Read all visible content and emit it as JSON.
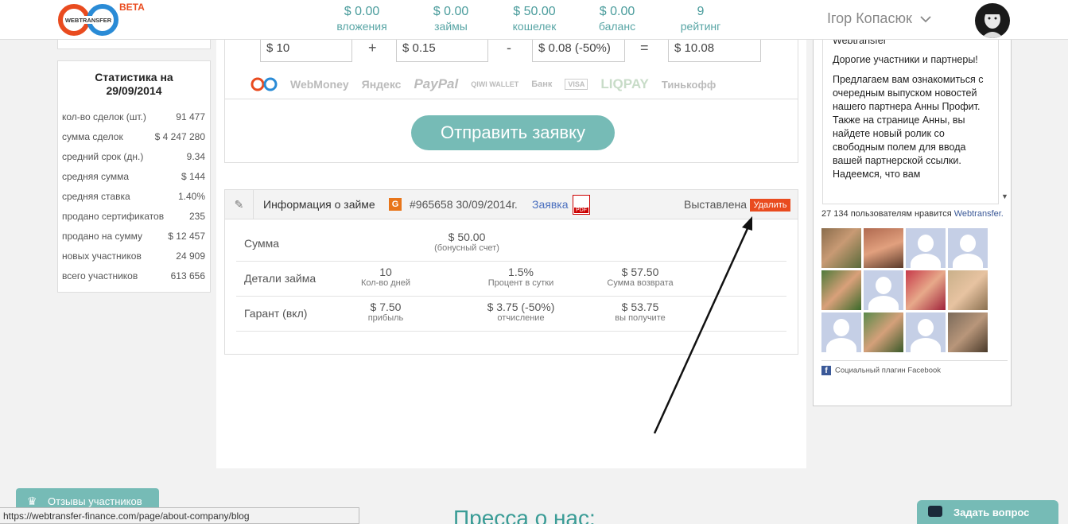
{
  "header": {
    "beta_label": "BETA",
    "stats": [
      {
        "value": "$ 0.00",
        "label": "вложения"
      },
      {
        "value": "$ 0.00",
        "label": "займы"
      },
      {
        "value": "$ 50.00",
        "label": "кошелек"
      },
      {
        "value": "$ 0.00",
        "label": "баланс"
      },
      {
        "value": "9",
        "label": "рейтинг"
      }
    ],
    "user_name": "Ігор Копасюк",
    "user_chevron_icon": "chevron-down-icon"
  },
  "sidebar": {
    "title": "Статистика на 29/09/2014",
    "rows": [
      {
        "label": "кол-во сделок (шт.)",
        "value": "91 477"
      },
      {
        "label": "сумма сделок",
        "value": "$ 4 247 280"
      },
      {
        "label": "средний срок (дн.)",
        "value": "9.34"
      },
      {
        "label": "средняя сумма",
        "value": "$ 144"
      },
      {
        "label": "средняя ставка",
        "value": "1.40%"
      },
      {
        "label": "продано сертификатов",
        "value": "235"
      },
      {
        "label": "продано на сумму",
        "value": "$ 12 457"
      },
      {
        "label": "новых участников",
        "value": "24 909"
      },
      {
        "label": "всего участников",
        "value": "613 656"
      }
    ]
  },
  "calc": {
    "amount": "$ 10",
    "plus": "+",
    "interest": "$ 0.15",
    "minus": "-",
    "fee": "$ 0.08 (-50%)",
    "equals": "=",
    "total": "$ 10.08"
  },
  "payments": [
    "WebMoney",
    "Яндекс",
    "PayPal",
    "QIWI WALLET",
    "Банк",
    "VISA",
    "LIQPAY",
    "Тинькофф"
  ],
  "submit_label": "Отправить заявку",
  "loan_info": {
    "title": "Информация о займе",
    "badge": "G",
    "id_date": "#965658 30/09/2014г.",
    "link": "Заявка",
    "status": "Выставлена",
    "delete_label": "Удалить",
    "rows": [
      {
        "label": "Сумма",
        "cells": [
          {
            "value": "$ 50.00",
            "sub": "(бонусный счет)"
          }
        ]
      },
      {
        "label": "Детали займа",
        "cells": [
          {
            "value": "10",
            "sub": "Кол-во дней"
          },
          {
            "value": "1.5%",
            "sub": "Процент в сутки"
          },
          {
            "value": "$ 57.50",
            "sub": "Сумма возврата"
          }
        ]
      },
      {
        "label": "Гарант (вкл)",
        "cells": [
          {
            "value": "$ 7.50",
            "sub": "прибыль"
          },
          {
            "value": "$ 3.75 (-50%)",
            "sub": "отчисление"
          },
          {
            "value": "$ 53.75",
            "sub": "вы получите"
          }
        ]
      }
    ]
  },
  "news": {
    "heading": "Webtransfer",
    "greeting": "Дорогие участники и партнеры!",
    "body": "Предлагаем вам ознакомиться с очередным выпуском новостей нашего партнера Анны Профит. Также на странице Анны, вы найдете новый ролик со свободным полем для ввода вашей партнерской ссылки. Надеемся, что вам"
  },
  "facebook": {
    "likes_text": "27 134 пользователям нравится ",
    "likes_link": "Webtransfer.",
    "footer": "Социальный плагин Facebook"
  },
  "bottom": {
    "reviews_tab": "Отзывы участников",
    "status_url": "https://webtransfer-finance.com/page/about-company/blog",
    "press_heading": "Пресса о нас:",
    "ask_button": "Задать вопрос"
  }
}
